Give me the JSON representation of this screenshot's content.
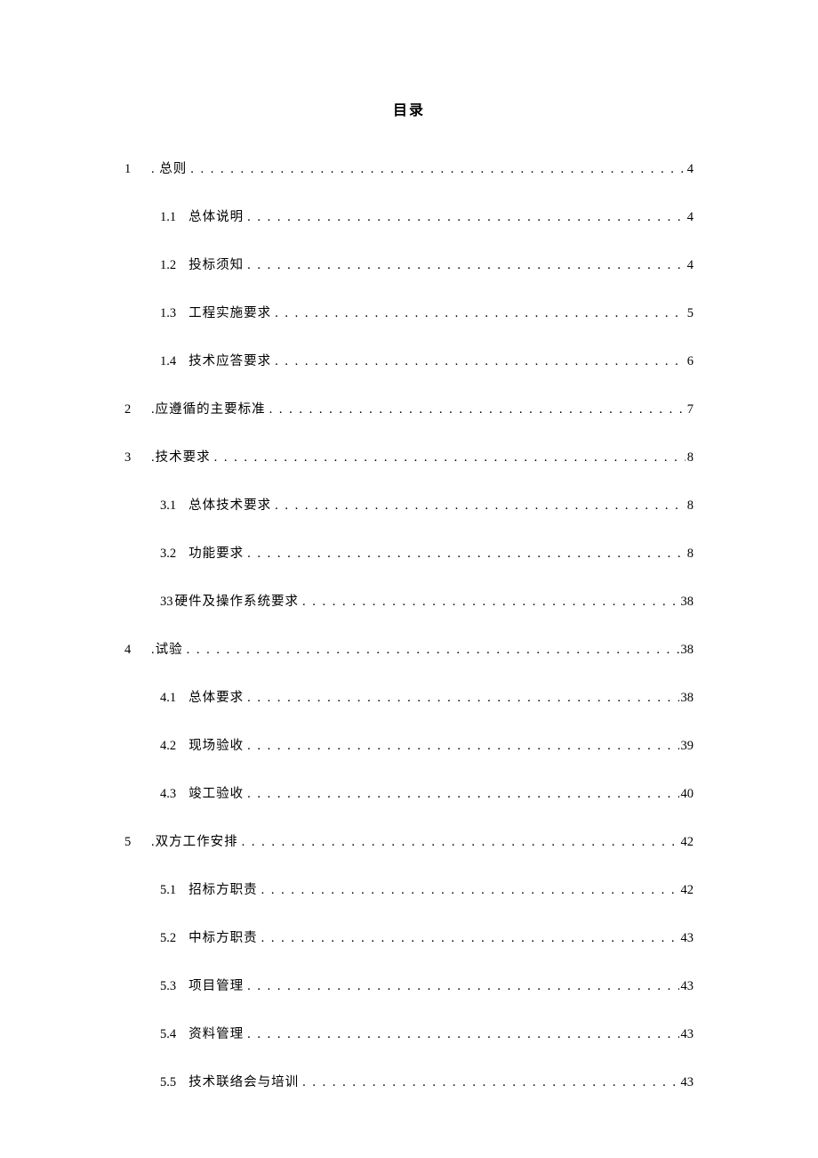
{
  "title": "目录",
  "entries": [
    {
      "level": 1,
      "num": "1",
      "text": ". 总则",
      "page": "4"
    },
    {
      "level": 2,
      "num": "1.1",
      "text": "总体说明",
      "page": "4"
    },
    {
      "level": 2,
      "num": "1.2",
      "text": "投标须知",
      "page": "4"
    },
    {
      "level": 2,
      "num": "1.3",
      "text": "工程实施要求",
      "page": "5"
    },
    {
      "level": 2,
      "num": "1.4",
      "text": "技术应答要求",
      "page": "6"
    },
    {
      "level": 1,
      "num": "2",
      "text": ".应遵循的主要标准",
      "page": "7"
    },
    {
      "level": 1,
      "num": "3",
      "text": ".技术要求",
      "page": "8"
    },
    {
      "level": 2,
      "num": "3.1",
      "text": "总体技术要求",
      "page": "8"
    },
    {
      "level": 2,
      "num": "3.2",
      "text": "功能要求",
      "page": "8"
    },
    {
      "level": 2,
      "num": "33",
      "text": "硬件及操作系统要求",
      "page": "38",
      "special": true
    },
    {
      "level": 1,
      "num": "4",
      "text": ".试验",
      "page": "38"
    },
    {
      "level": 2,
      "num": "4.1",
      "text": "总体要求",
      "page": "38"
    },
    {
      "level": 2,
      "num": "4.2",
      "text": "现场验收",
      "page": "39"
    },
    {
      "level": 2,
      "num": "4.3",
      "text": "竣工验收",
      "page": "40"
    },
    {
      "level": 1,
      "num": "5",
      "text": ".双方工作安排",
      "page": "42"
    },
    {
      "level": 2,
      "num": "5.1",
      "text": "招标方职责",
      "page": "42"
    },
    {
      "level": 2,
      "num": "5.2",
      "text": "中标方职责",
      "page": "43"
    },
    {
      "level": 2,
      "num": "5.3",
      "text": "项目管理",
      "page": "43"
    },
    {
      "level": 2,
      "num": "5.4",
      "text": "资料管理",
      "page": "43"
    },
    {
      "level": 2,
      "num": "5.5",
      "text": "技术联络会与培训",
      "page": "43"
    }
  ]
}
